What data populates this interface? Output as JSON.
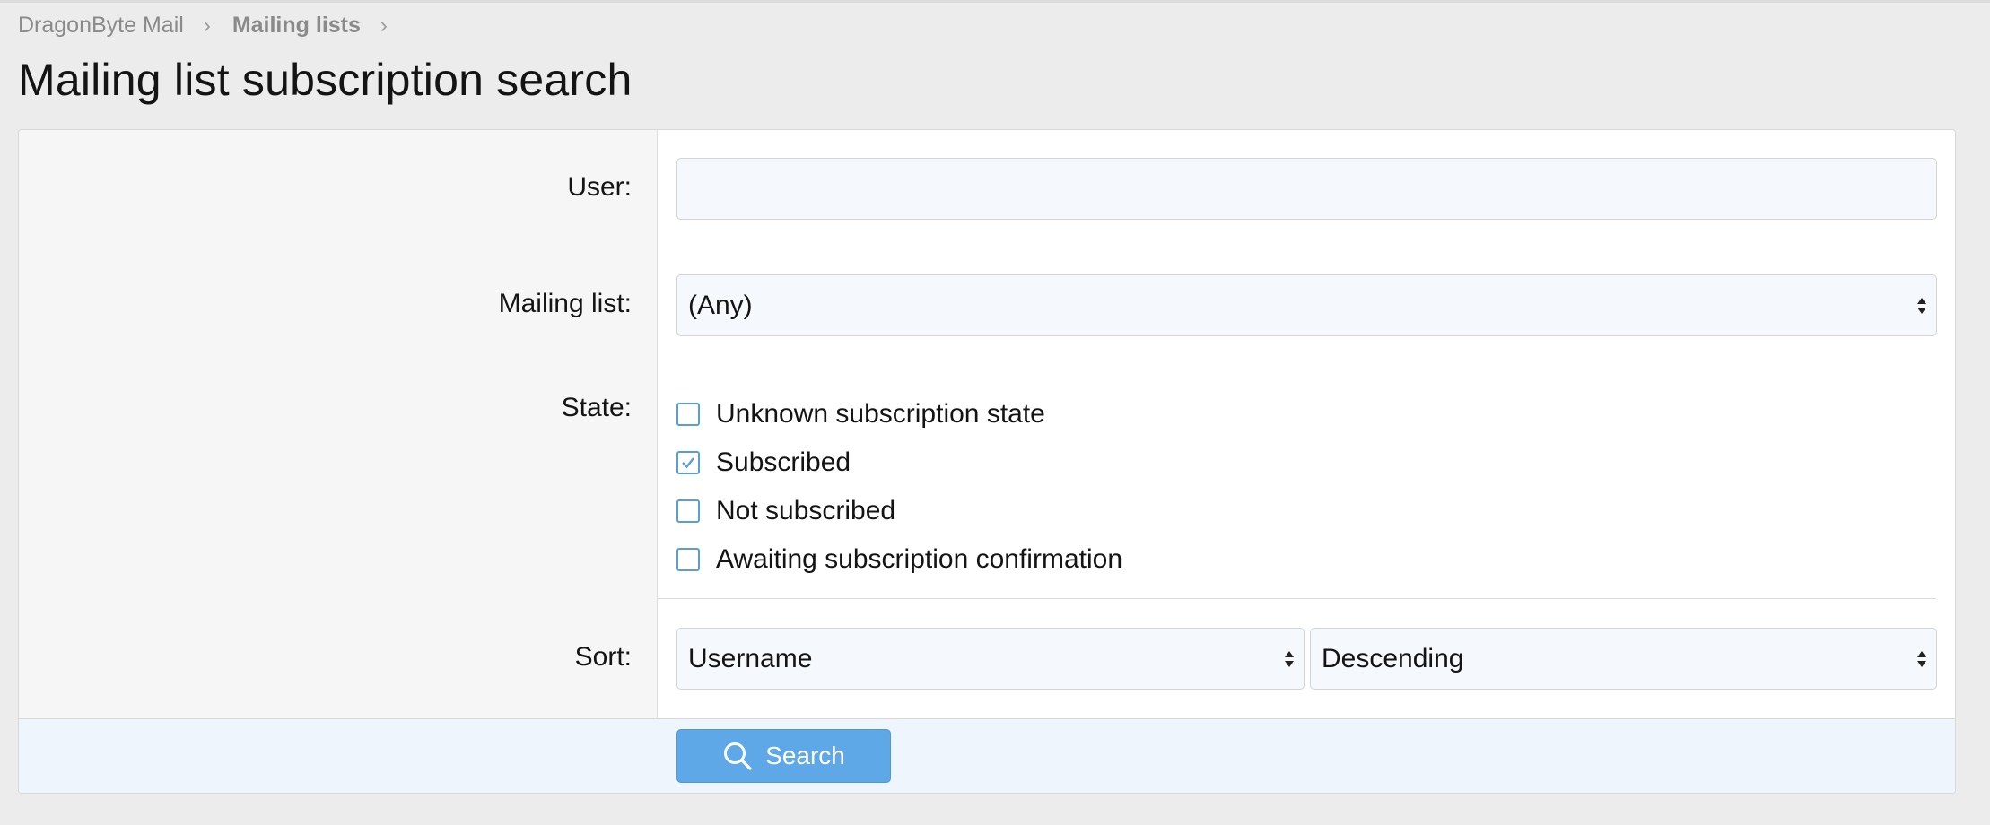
{
  "breadcrumb": {
    "items": [
      "DragonByte Mail",
      "Mailing lists"
    ],
    "separator": "›"
  },
  "page": {
    "title": "Mailing list subscription search"
  },
  "form": {
    "user": {
      "label": "User:",
      "value": ""
    },
    "mailing_list": {
      "label": "Mailing list:",
      "selected": "(Any)"
    },
    "state": {
      "label": "State:",
      "options": [
        {
          "label": "Unknown subscription state",
          "checked": false
        },
        {
          "label": "Subscribed",
          "checked": true
        },
        {
          "label": "Not subscribed",
          "checked": false
        },
        {
          "label": "Awaiting subscription confirmation",
          "checked": false
        }
      ]
    },
    "sort": {
      "label": "Sort:",
      "field_selected": "Username",
      "direction_selected": "Descending"
    },
    "search_button": {
      "label": "Search",
      "icon": "search-icon"
    }
  },
  "colors": {
    "accent": "#5ea8e8",
    "checkbox_border": "#5a9fd2",
    "background": "#ececec"
  }
}
